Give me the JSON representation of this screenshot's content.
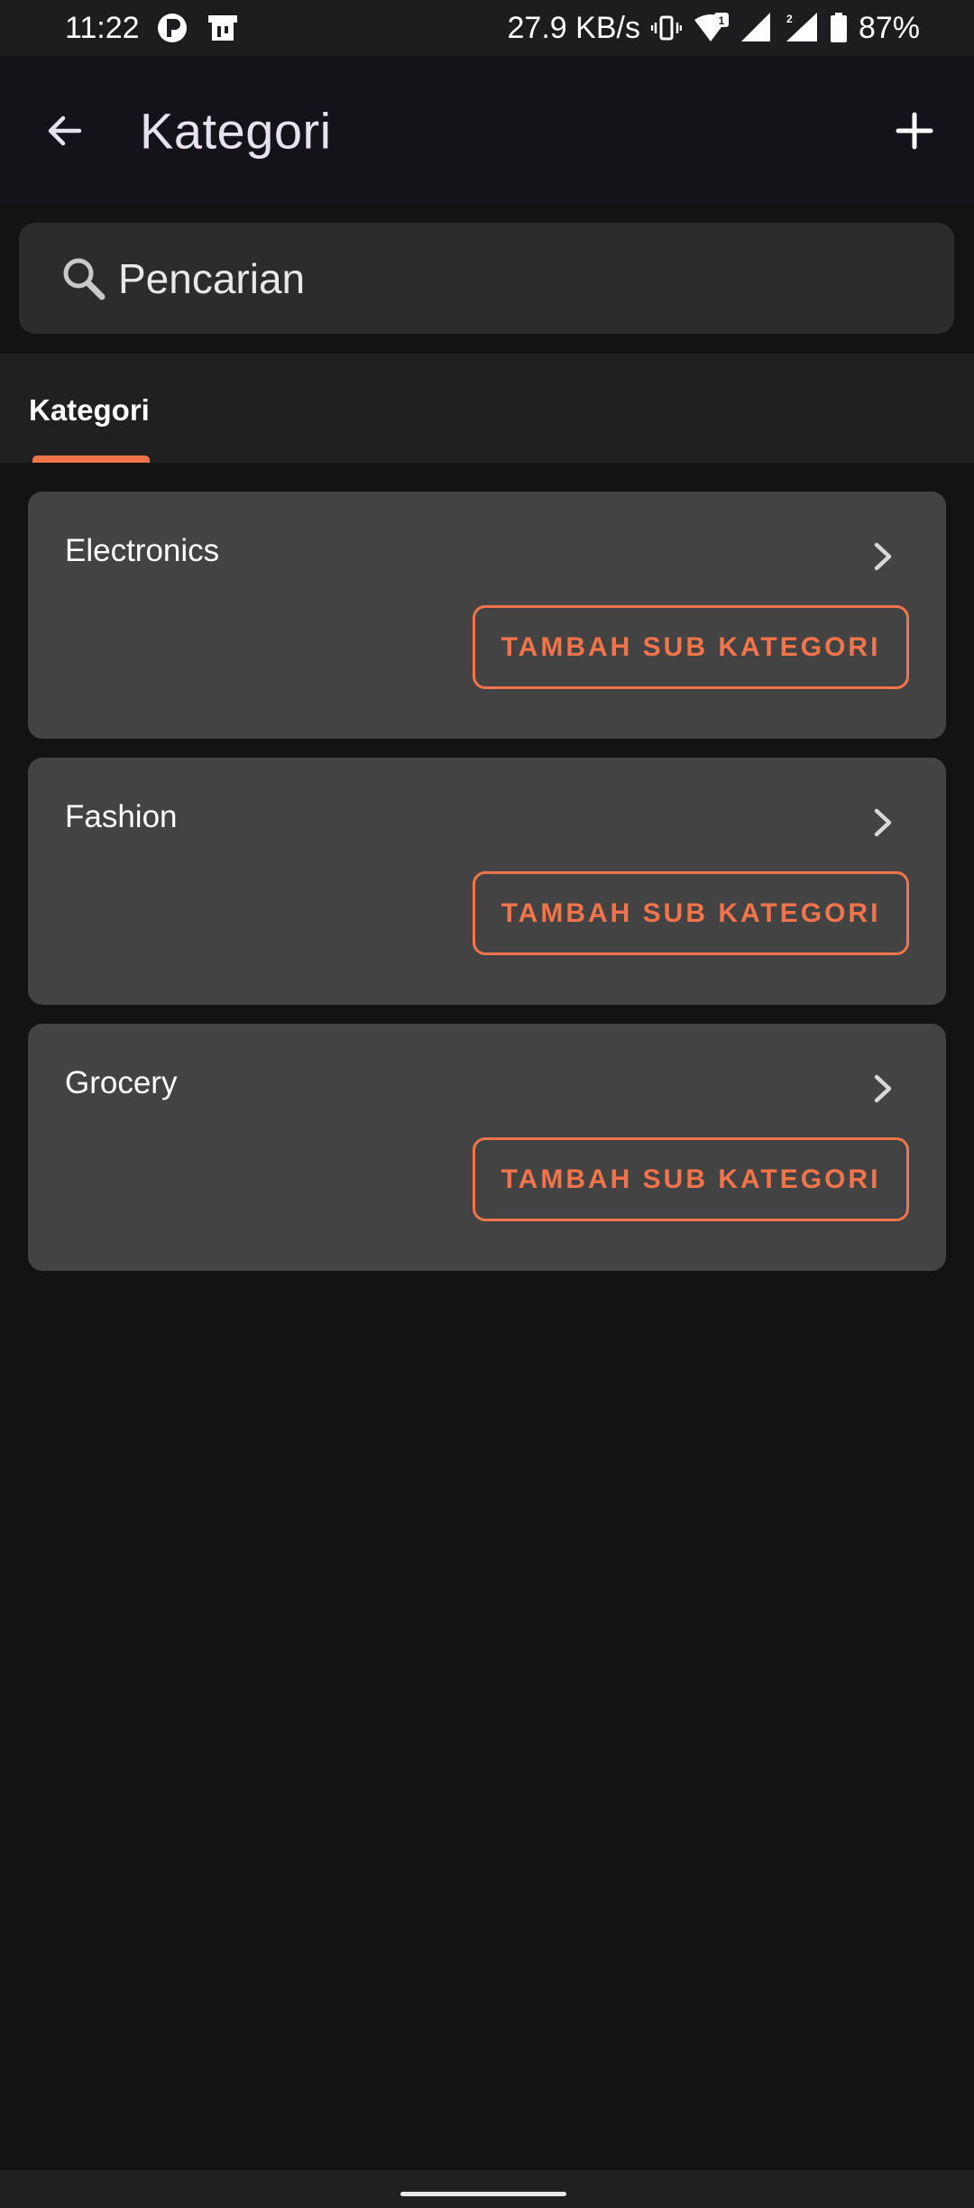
{
  "status_bar": {
    "time": "11:22",
    "network_speed": "27.9 KB/s",
    "battery": "87%",
    "sim1_badge": "1",
    "sim2_badge": "2"
  },
  "app_bar": {
    "title": "Kategori"
  },
  "search": {
    "placeholder": "Pencarian"
  },
  "tabs": [
    {
      "label": "Kategori",
      "selected": true
    }
  ],
  "categories": [
    {
      "name": "Electronics",
      "button_label": "TAMBAH SUB KATEGORI"
    },
    {
      "name": "Fashion",
      "button_label": "TAMBAH SUB KATEGORI"
    },
    {
      "name": "Grocery",
      "button_label": "TAMBAH SUB KATEGORI"
    }
  ],
  "colors": {
    "accent": "#f2744b",
    "card": "#434343",
    "background": "#131313"
  }
}
